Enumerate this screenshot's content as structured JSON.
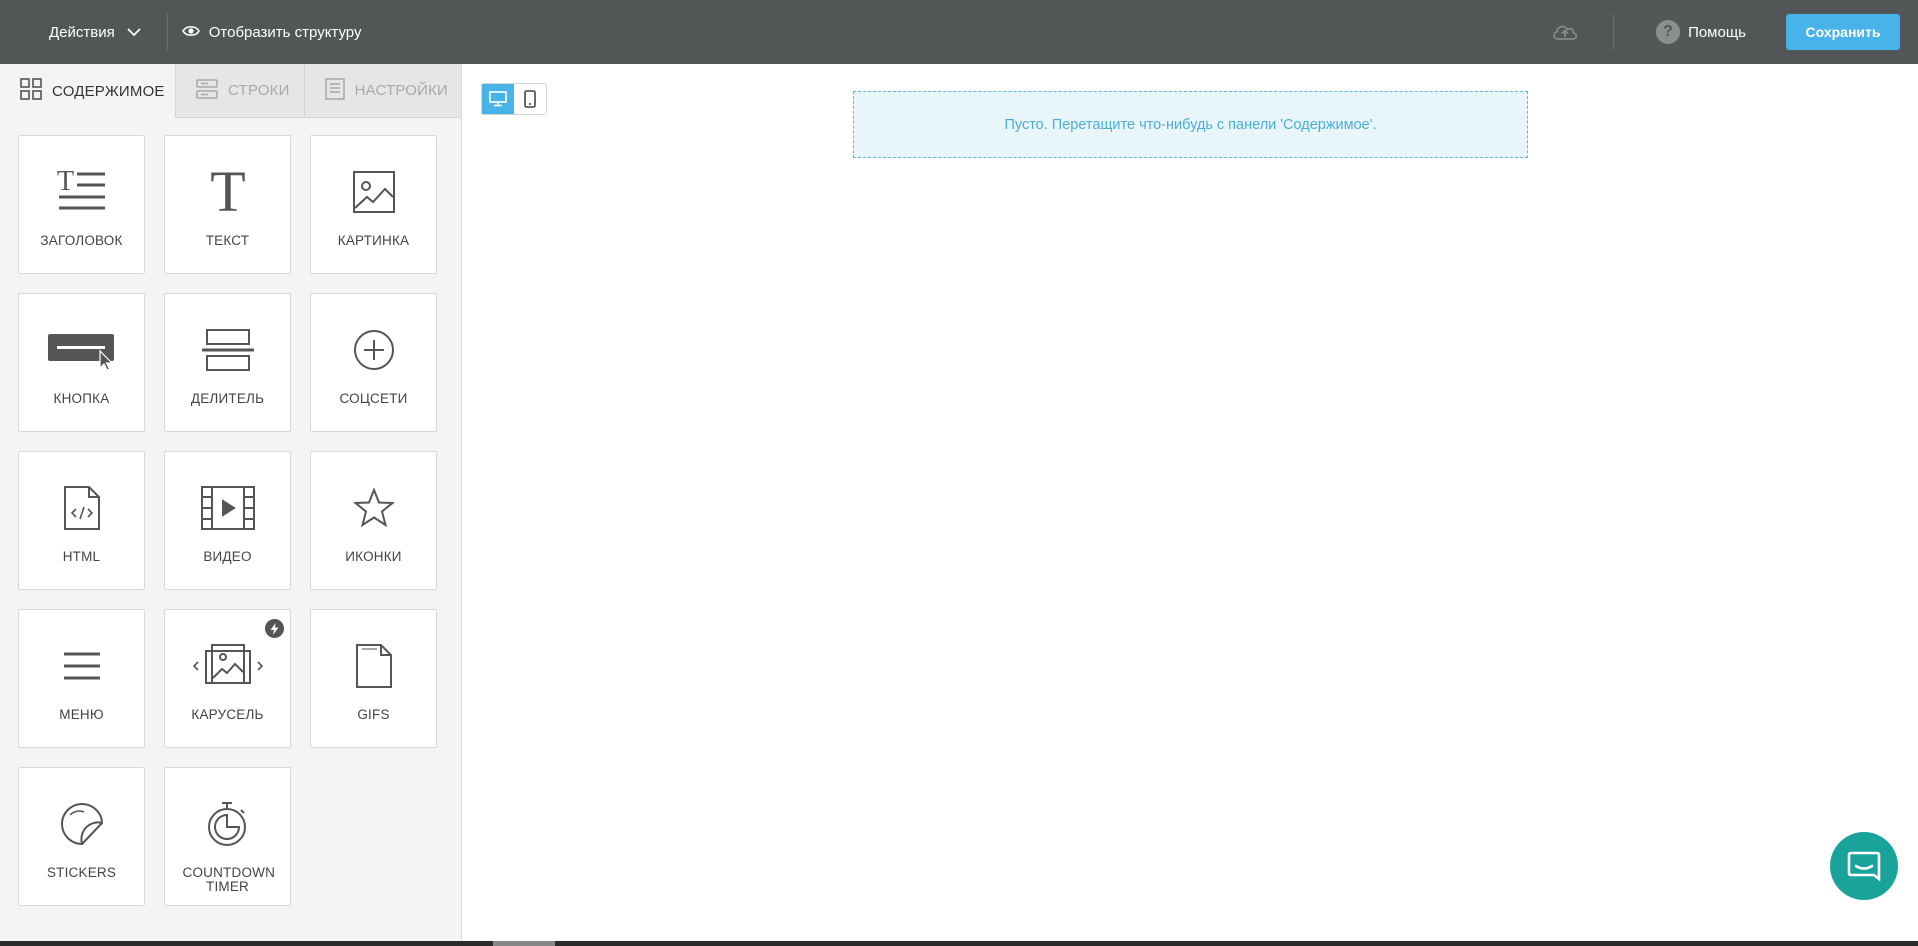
{
  "topbar": {
    "actions_label": "Действия",
    "structure_label": "Отобразить структуру",
    "help_label": "Помощь",
    "save_label": "Сохранить"
  },
  "tabs": [
    {
      "label": "СОДЕРЖИМОЕ",
      "icon": "grid-icon",
      "active": true
    },
    {
      "label": "СТРОКИ",
      "icon": "rows-icon",
      "active": false
    },
    {
      "label": "НАСТРОЙКИ",
      "icon": "settings-list-icon",
      "active": false
    }
  ],
  "tiles": [
    {
      "label": "ЗАГОЛОВОК",
      "icon": "heading-icon"
    },
    {
      "label": "ТЕКСТ",
      "icon": "text-icon"
    },
    {
      "label": "КАРТИНКА",
      "icon": "image-icon"
    },
    {
      "label": "КНОПКА",
      "icon": "button-icon"
    },
    {
      "label": "ДЕЛИТЕЛЬ",
      "icon": "divider-icon"
    },
    {
      "label": "СОЦСЕТИ",
      "icon": "social-icon"
    },
    {
      "label": "HTML",
      "icon": "html-file-icon"
    },
    {
      "label": "ВИДЕО",
      "icon": "video-icon"
    },
    {
      "label": "ИКОНКИ",
      "icon": "star-icon"
    },
    {
      "label": "МЕНЮ",
      "icon": "menu-icon"
    },
    {
      "label": "КАРУСЕЛЬ",
      "icon": "carousel-icon"
    },
    {
      "label": "GIFS",
      "icon": "gif-file-icon"
    },
    {
      "label": "STICKERS",
      "icon": "sticker-icon"
    },
    {
      "label": "COUNTDOWN TIMER",
      "icon": "timer-icon"
    }
  ],
  "canvas": {
    "empty_message": "Пусто. Перетащите что-нибудь с панели 'Содержимое'."
  },
  "colors": {
    "topbar": "#535657",
    "accent": "#47b3e8",
    "chat": "#1aa39a"
  }
}
